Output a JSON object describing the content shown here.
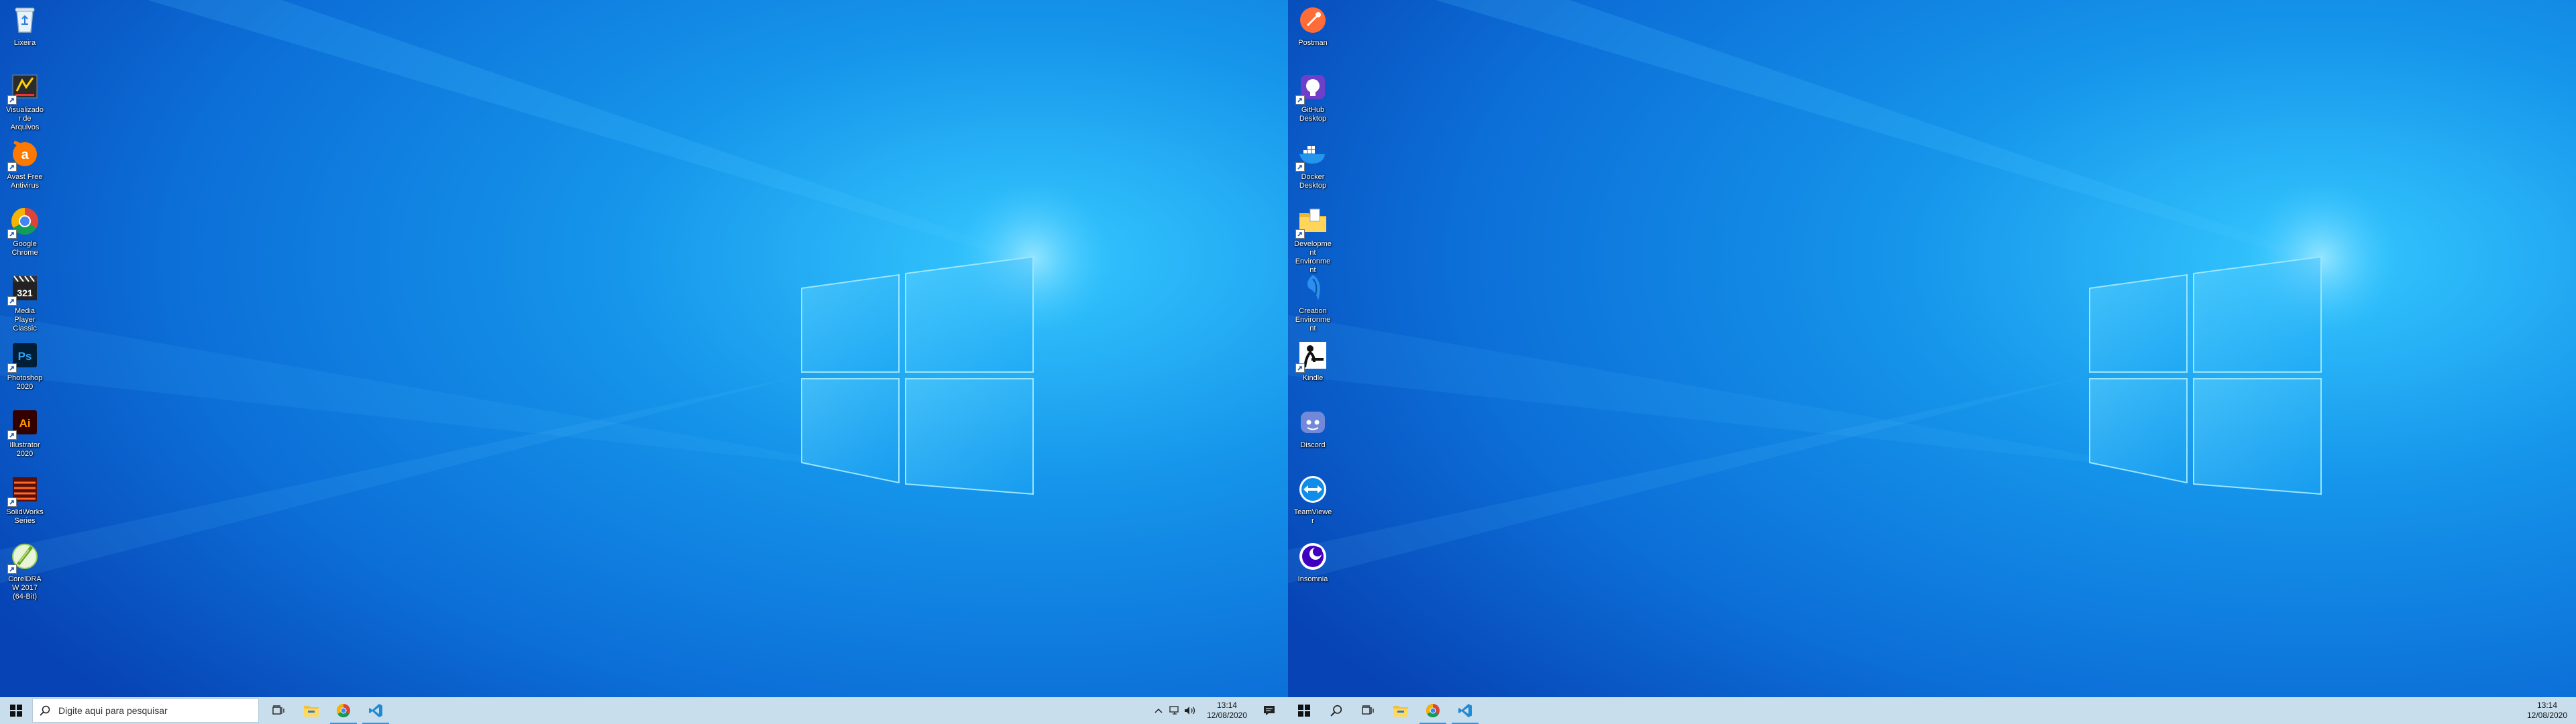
{
  "colors": {
    "wallpaper_dark": "#0a4fc7",
    "wallpaper_light": "#26b5ff",
    "taskbar": "#c9deec",
    "active_indicator": "#3a8fe0"
  },
  "left_monitor": {
    "desktop_icons": [
      {
        "label": "Lixeira",
        "icon": "recycle-bin-icon"
      },
      {
        "label": "Visualizador de Arquivos",
        "icon": "file-viewer-icon"
      },
      {
        "label": "Avast Free Antivirus",
        "icon": "avast-icon"
      },
      {
        "label": "Google Chrome",
        "icon": "chrome-icon"
      },
      {
        "label": "Media Player Classic",
        "icon": "media-player-classic-icon"
      },
      {
        "label": "Photoshop 2020",
        "icon": "photoshop-icon"
      },
      {
        "label": "Illustrator 2020",
        "icon": "illustrator-icon"
      },
      {
        "label": "SolidWorks Series",
        "icon": "solidworks-icon"
      },
      {
        "label": "CorelDRAW 2017 (64-Bit)",
        "icon": "coreldraw-icon"
      }
    ],
    "taskbar": {
      "search_placeholder": "Digite aqui para pesquisar",
      "pinned": [
        "task-view-icon",
        "file-explorer-icon",
        "chrome-icon",
        "vscode-icon"
      ],
      "tray_icons": [
        "chevron-up-icon",
        "network-icon",
        "volume-icon"
      ],
      "time": "13:14",
      "date": "12/08/2020"
    }
  },
  "right_monitor": {
    "desktop_icons": [
      {
        "label": "Postman",
        "icon": "postman-icon"
      },
      {
        "label": "GitHub Desktop",
        "icon": "github-desktop-icon"
      },
      {
        "label": "Docker Desktop",
        "icon": "docker-icon"
      },
      {
        "label": "Development Environment",
        "icon": "folder-icon"
      },
      {
        "label": "Creation Environment",
        "icon": "creation-icon"
      },
      {
        "label": "Kindle",
        "icon": "kindle-icon"
      },
      {
        "label": "Discord",
        "icon": "discord-icon"
      },
      {
        "label": "TeamViewer",
        "icon": "teamviewer-icon"
      },
      {
        "label": "Insomnia",
        "icon": "insomnia-icon"
      }
    ],
    "taskbar": {
      "pinned": [
        "search-icon",
        "task-view-icon",
        "file-explorer-icon",
        "chrome-icon",
        "vscode-icon"
      ],
      "time": "13:14",
      "date": "12/08/2020"
    }
  }
}
